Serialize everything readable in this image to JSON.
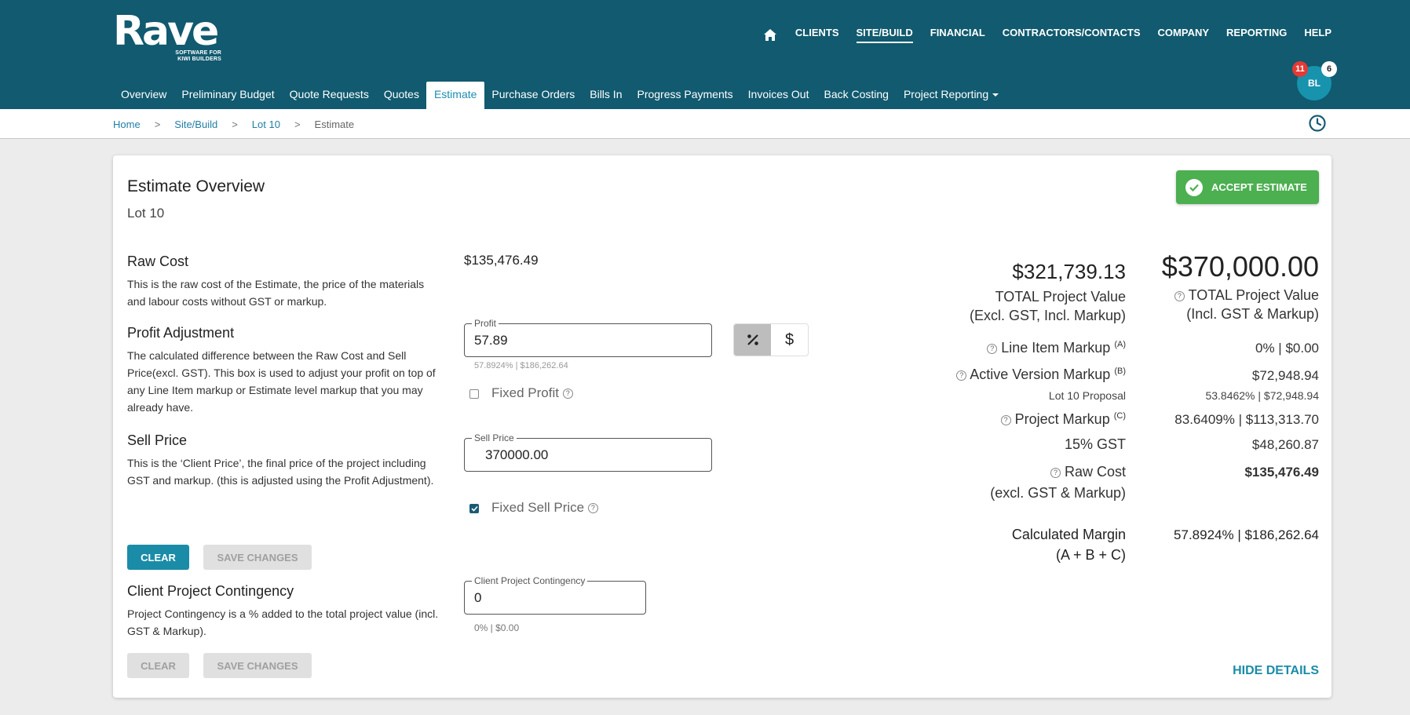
{
  "brand": {
    "name": "Rave",
    "tagline": "SOFTWARE FOR KIWI BUILDERS"
  },
  "main_nav": [
    {
      "label": "CLIENTS",
      "active": false
    },
    {
      "label": "SITE/BUILD",
      "active": true
    },
    {
      "label": "FINANCIAL",
      "active": false
    },
    {
      "label": "CONTRACTORS/CONTACTS",
      "active": false
    },
    {
      "label": "COMPANY",
      "active": false
    },
    {
      "label": "REPORTING",
      "active": false
    },
    {
      "label": "HELP",
      "active": false
    }
  ],
  "sub_nav": [
    {
      "label": "Overview"
    },
    {
      "label": "Preliminary Budget"
    },
    {
      "label": "Quote Requests"
    },
    {
      "label": "Quotes"
    },
    {
      "label": "Estimate",
      "active": true
    },
    {
      "label": "Purchase Orders"
    },
    {
      "label": "Bills In"
    },
    {
      "label": "Progress Payments"
    },
    {
      "label": "Invoices Out"
    },
    {
      "label": "Back Costing"
    },
    {
      "label": "Project Reporting",
      "dropdown": true
    }
  ],
  "user": {
    "initials": "BL",
    "badge_red": "11",
    "badge_white": "6"
  },
  "breadcrumb": {
    "home": "Home",
    "site_build": "Site/Build",
    "lot": "Lot 10",
    "current": "Estimate",
    "separator": ">"
  },
  "card": {
    "title": "Estimate Overview",
    "subtitle": "Lot 10",
    "accept_label": "ACCEPT ESTIMATE",
    "raw_cost": {
      "heading": "Raw Cost",
      "description": "This is the raw cost of the Estimate, the price of the materials and labour costs without GST or markup.",
      "value": "$135,476.49"
    },
    "profit_adjustment": {
      "heading": "Profit Adjustment",
      "description": "The calculated difference between the Raw Cost and Sell Price(excl. GST). This box is used to adjust your profit on top of any Line Item markup or Estimate level markup that you may already have.",
      "field_label": "Profit",
      "field_value": "57.89",
      "hint": "57.8924% | $186,262.64",
      "fixed_label": "Fixed Profit",
      "fixed_checked": false,
      "toggle_percent": "%",
      "toggle_dollar": "$"
    },
    "sell_price": {
      "heading": "Sell Price",
      "description": "This is the ‘Client Price’, the final price of the project including GST and markup. (this is adjusted using the Profit Adjustment).",
      "field_label": "Sell Price",
      "field_value": "370000.00",
      "fixed_label": "Fixed Sell Price",
      "fixed_checked": true
    },
    "buttons": {
      "clear": "CLEAR",
      "save": "SAVE CHANGES"
    },
    "contingency": {
      "heading": "Client Project Contingency",
      "description": "Project Contingency is a % added to the total project value (incl. GST & Markup).",
      "field_label": "Client Project Contingency",
      "field_value": "0",
      "hint": "0% | $0.00"
    },
    "summary": {
      "excl_value": "$321,739.13",
      "excl_label_1": "TOTAL Project Value",
      "excl_label_2": "(Excl. GST, Incl. Markup)",
      "incl_value": "$370,000.00",
      "incl_label_1": "TOTAL Project Value",
      "incl_label_2": "(Incl. GST & Markup)",
      "line_item_label": "Line Item Markup",
      "line_item_sup": "(A)",
      "line_item_value": "0% | $0.00",
      "active_version_label": "Active Version Markup",
      "active_version_sup": "(B)",
      "active_version_value": "$72,948.94",
      "active_version_name": "Lot 10 Proposal",
      "active_version_detail": "53.8462% | $72,948.94",
      "project_markup_label": "Project Markup",
      "project_markup_sup": "(C)",
      "project_markup_value": "83.6409% | $113,313.70",
      "gst_label": "15% GST",
      "gst_value": "$48,260.87",
      "raw_cost_label_1": "Raw Cost",
      "raw_cost_label_2": "(excl. GST & Markup)",
      "raw_cost_value": "$135,476.49",
      "margin_label_1": "Calculated Margin",
      "margin_label_2": "(A + B + C)",
      "margin_value": "57.8924% | $186,262.64"
    },
    "hide_details": "HIDE DETAILS"
  }
}
